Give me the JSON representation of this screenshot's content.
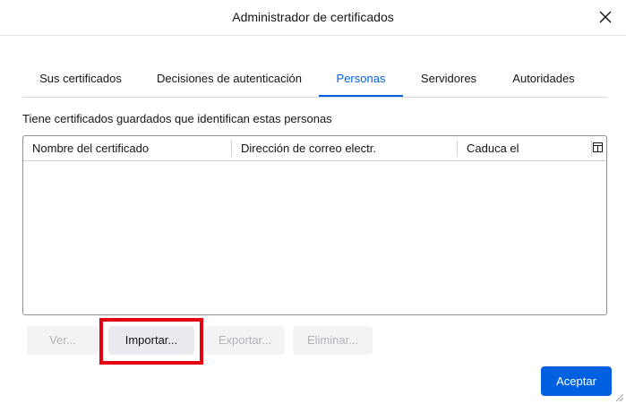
{
  "window": {
    "title": "Administrador de certificados"
  },
  "tabs": [
    {
      "label": "Sus certificados",
      "active": false
    },
    {
      "label": "Decisiones de autenticación",
      "active": false
    },
    {
      "label": "Personas",
      "active": true
    },
    {
      "label": "Servidores",
      "active": false
    },
    {
      "label": "Autoridades",
      "active": false
    }
  ],
  "description": "Tiene certificados guardados que identifican estas personas",
  "table": {
    "columns": [
      "Nombre del certificado",
      "Dirección de correo electr.",
      "Caduca el"
    ],
    "rows": []
  },
  "buttons": {
    "view": "Ver...",
    "import": "Importar...",
    "export": "Exportar...",
    "delete": "Eliminar...",
    "accept": "Aceptar"
  },
  "colors": {
    "accent": "#0061e0",
    "highlight": "#e3000f"
  }
}
